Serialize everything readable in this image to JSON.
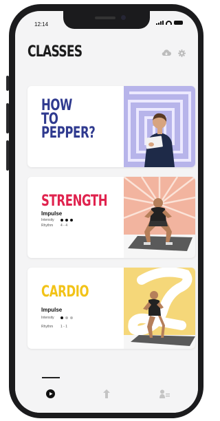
{
  "status": {
    "time": "12:14"
  },
  "header": {
    "title": "CLASSES"
  },
  "icons": {
    "cloud": "cloud-download-icon",
    "settings": "gear-icon"
  },
  "cards": [
    {
      "title_lines": [
        "HOW",
        "TO",
        "PEPPER?"
      ],
      "color": "#2f3a8f"
    },
    {
      "title": "STRENGTH",
      "color": "#e0234e",
      "name": "Impulse",
      "intensity_label": "Intensity",
      "rhythm_label": "Rhythm",
      "rhythm_value": "4 - 4",
      "intensity_level": 3
    },
    {
      "title": "CARDIO",
      "color": "#f2c318",
      "name": "Impulse",
      "intensity_label": "Intensity",
      "rhythm_label": "Rhythm",
      "rhythm_value": "1 - 1",
      "intensity_level": 1
    }
  ],
  "tabs": [
    {
      "icon": "play-icon",
      "active": true
    },
    {
      "icon": "upload-arrow-icon",
      "active": false
    },
    {
      "icon": "profile-list-icon",
      "active": false
    }
  ]
}
